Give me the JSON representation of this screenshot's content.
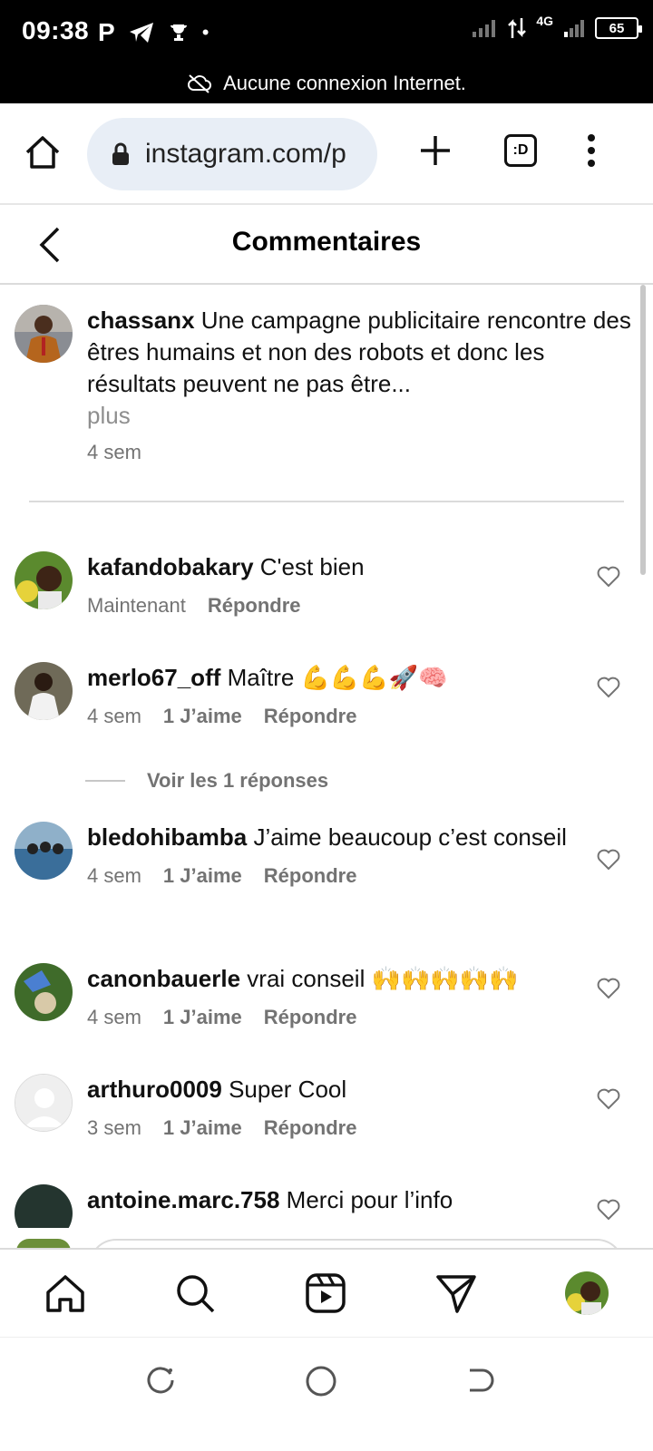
{
  "status_bar": {
    "time": "09:38",
    "battery": "65",
    "network": "4G"
  },
  "offline_banner": "Aucune connexion Internet.",
  "browser": {
    "url": "instagram.com/p",
    "tabs_label": ":D"
  },
  "header": {
    "title": "Commentaires"
  },
  "caption": {
    "username": "chassanx",
    "text": "Une campagne publicitaire rencontre des êtres humains et non des robots et donc les résultats peuvent ne pas être...",
    "more": "plus",
    "time": "4 sem"
  },
  "comments": [
    {
      "username": "kafandobakary",
      "text": "C'est bien",
      "time": "Maintenant",
      "likes": "",
      "reply": "Répondre"
    },
    {
      "username": "merlo67_off",
      "text": "Maître 💪💪💪🚀🧠",
      "time": "4 sem",
      "likes": "1 J’aime",
      "reply": "Répondre"
    },
    {
      "username": "bledohibamba",
      "text": "J’aime beaucoup c’est conseil",
      "time": "4 sem",
      "likes": "1 J’aime",
      "reply": "Répondre"
    },
    {
      "username": "canonbauerle",
      "text": "vrai conseil 🙌🙌🙌🙌🙌",
      "time": "4 sem",
      "likes": "1 J’aime",
      "reply": "Répondre"
    },
    {
      "username": "arthuro0009",
      "text": "Super Cool",
      "time": "3 sem",
      "likes": "1 J’aime",
      "reply": "Répondre"
    },
    {
      "username": "antoine.marc.758",
      "text": "Merci pour l’info",
      "time": "",
      "likes": "",
      "reply": ""
    }
  ],
  "view_replies": "Voir les 1 réponses",
  "colors": {
    "secondary_text": "#737373",
    "url_bg": "#e8eef6",
    "divider": "#dbdbdb"
  }
}
